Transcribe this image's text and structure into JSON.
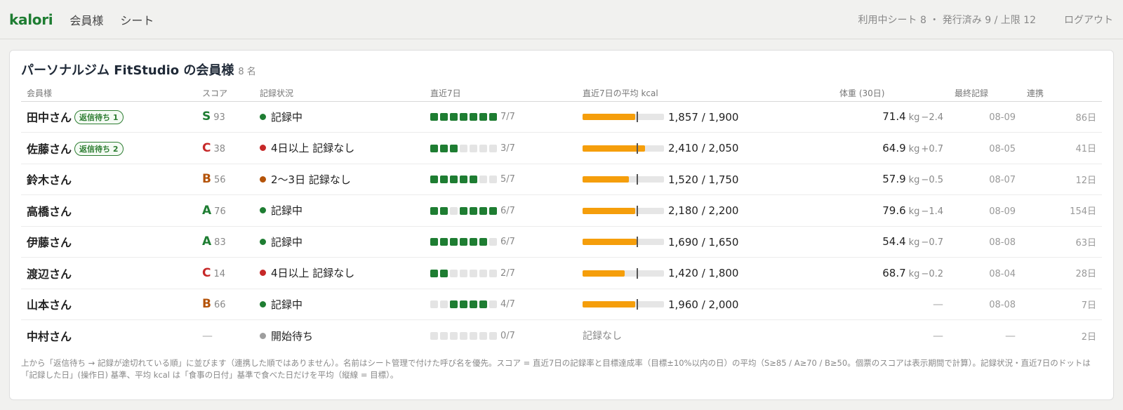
{
  "header": {
    "brand": "kalori",
    "nav": [
      "会員様",
      "シート"
    ],
    "quota": "利用中シート 8 ・ 発行済み 9 / 上限 12",
    "logout": "ログアウト"
  },
  "card": {
    "title": "パーソナルジム FitStudio の会員様",
    "count": "8 名",
    "columns": [
      "会員様",
      "スコア",
      "記録状況",
      "直近7日",
      "直近7日の平均 kcal",
      "体重 (30日)",
      "最終記録",
      "連携"
    ],
    "rows": [
      {
        "name": "田中さん",
        "badge": "返信待ち 1",
        "grade": "S",
        "grade_color": "#1e7d32",
        "score": "93",
        "status_color": "#1e7d32",
        "status": "記録中",
        "dots": [
          1,
          1,
          1,
          1,
          1,
          1,
          1
        ],
        "days": "7/7",
        "kcal_fill": 0.65,
        "kcal": "1,857 / 1,900",
        "weight": "71.4",
        "unit": "kg",
        "diff": "−2.4",
        "last": "08-09",
        "linked": "86日"
      },
      {
        "name": "佐藤さん",
        "badge": "返信待ち 2",
        "grade": "C",
        "grade_color": "#c62828",
        "score": "38",
        "status_color": "#c62828",
        "status": "4日以上 記録なし",
        "dots": [
          1,
          1,
          1,
          0,
          0,
          0,
          0
        ],
        "days": "3/7",
        "kcal_fill": 0.77,
        "kcal": "2,410 / 2,050",
        "weight": "64.9",
        "unit": "kg",
        "diff": "+0.7",
        "last": "08-05",
        "linked": "41日"
      },
      {
        "name": "鈴木さん",
        "badge": "",
        "grade": "B",
        "grade_color": "#b45309",
        "score": "56",
        "status_color": "#b45309",
        "status": "2〜3日 記録なし",
        "dots": [
          1,
          1,
          1,
          1,
          1,
          0,
          0
        ],
        "days": "5/7",
        "kcal_fill": 0.57,
        "kcal": "1,520 / 1,750",
        "weight": "57.9",
        "unit": "kg",
        "diff": "−0.5",
        "last": "08-07",
        "linked": "12日"
      },
      {
        "name": "高橋さん",
        "badge": "",
        "grade": "A",
        "grade_color": "#1e7d32",
        "score": "76",
        "status_color": "#1e7d32",
        "status": "記録中",
        "dots": [
          1,
          1,
          0,
          1,
          1,
          1,
          1
        ],
        "days": "6/7",
        "kcal_fill": 0.65,
        "kcal": "2,180 / 2,200",
        "weight": "79.6",
        "unit": "kg",
        "diff": "−1.4",
        "last": "08-09",
        "linked": "154日"
      },
      {
        "name": "伊藤さん",
        "badge": "",
        "grade": "A",
        "grade_color": "#1e7d32",
        "score": "83",
        "status_color": "#1e7d32",
        "status": "記録中",
        "dots": [
          1,
          1,
          1,
          1,
          1,
          1,
          0
        ],
        "days": "6/7",
        "kcal_fill": 0.66,
        "kcal": "1,690 / 1,650",
        "weight": "54.4",
        "unit": "kg",
        "diff": "−0.7",
        "last": "08-08",
        "linked": "63日"
      },
      {
        "name": "渡辺さん",
        "badge": "",
        "grade": "C",
        "grade_color": "#c62828",
        "score": "14",
        "status_color": "#c62828",
        "status": "4日以上 記録なし",
        "dots": [
          1,
          1,
          0,
          0,
          0,
          0,
          0
        ],
        "days": "2/7",
        "kcal_fill": 0.52,
        "kcal": "1,420 / 1,800",
        "weight": "68.7",
        "unit": "kg",
        "diff": "−0.2",
        "last": "08-04",
        "linked": "28日"
      },
      {
        "name": "山本さん",
        "badge": "",
        "grade": "B",
        "grade_color": "#b45309",
        "score": "66",
        "status_color": "#1e7d32",
        "status": "記録中",
        "dots": [
          0,
          0,
          1,
          1,
          1,
          1,
          0
        ],
        "days": "4/7",
        "kcal_fill": 0.65,
        "kcal": "1,960 / 2,000",
        "weight": "",
        "unit": "",
        "diff": "",
        "last": "08-08",
        "linked": "7日"
      },
      {
        "name": "中村さん",
        "badge": "",
        "grade": "",
        "grade_color": "#999999",
        "score": "",
        "status_color": "#9e9e9e",
        "status": "開始待ち",
        "dots": [
          0,
          0,
          0,
          0,
          0,
          0,
          0
        ],
        "days": "0/7",
        "kcal_fill": null,
        "kcal": "記録なし",
        "weight": "",
        "unit": "",
        "diff": "",
        "last": "",
        "linked": "2日"
      }
    ],
    "empty": "—",
    "footnote": "上から「返信待ち → 記録が途切れている順」に並びます（連携した順ではありません）。名前はシート管理で付けた呼び名を優先。スコア = 直近7日の記録率と目標達成率（目標±10%以内の日）の平均（S≥85 / A≥70 / B≥50。個票のスコアは表示期間で計算）。記録状況・直近7日のドットは「記録した日」(操作日) 基準、平均 kcal は「食事の日付」基準で食べた日だけを平均（縦線 = 目標）。"
  }
}
